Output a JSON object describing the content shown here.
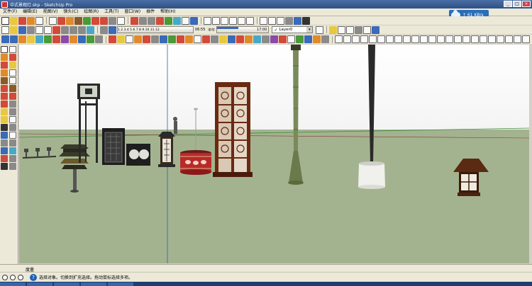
{
  "window": {
    "title": "中式景观灯.skp - SketchUp Pro",
    "min_label": "_",
    "max_label": "□",
    "close_label": "×"
  },
  "menu": [
    "文件(F)",
    "编辑(E)",
    "视图(V)",
    "镜头(C)",
    "绘图(R)",
    "工具(T)",
    "窗口(W)",
    "插件",
    "帮助(H)"
  ],
  "network": {
    "speed": "↑ 61 KB/s"
  },
  "shadow_strip": {
    "months": "1 2 3 4 5 6 7 8 9 10 11 12",
    "time_start": "06:55",
    "ampm": "中午",
    "time_end": "17:00"
  },
  "layer": {
    "value": "Layer0"
  },
  "measurement": {
    "label": "度量"
  },
  "status": {
    "message": "选择对象。切换到扩充选择。拖动鼠标选择多项。"
  },
  "colors": {
    "sky": "#ffffff",
    "ground": "#a3b38f",
    "horizon": "#3c8c3c"
  }
}
